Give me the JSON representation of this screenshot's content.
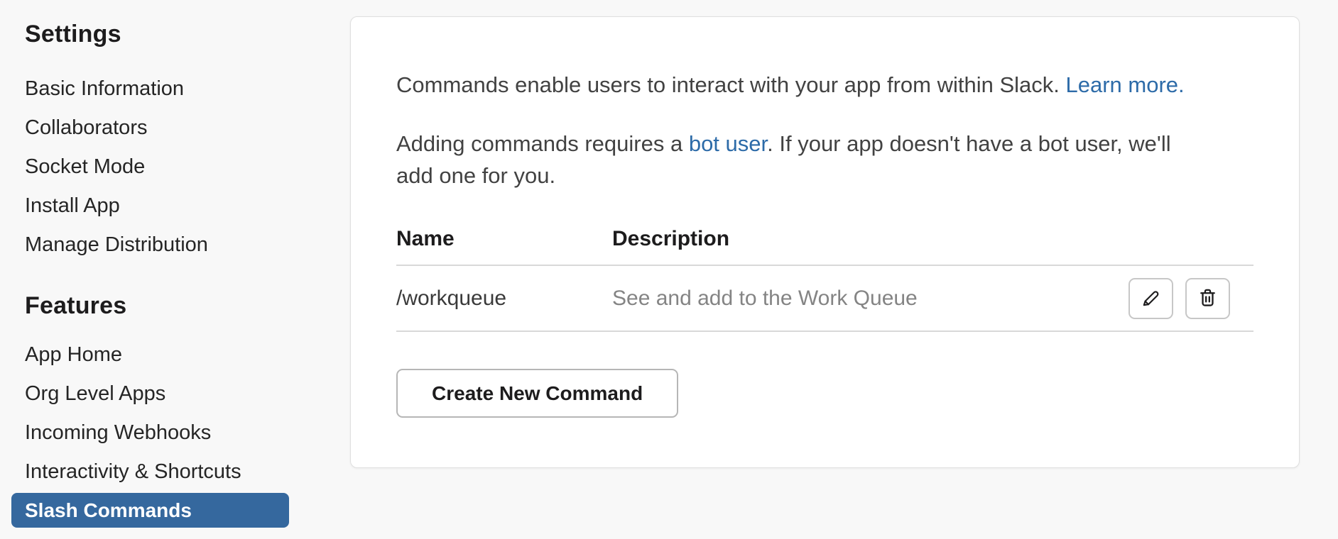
{
  "colors": {
    "accent": "#35689e",
    "link": "#2d6ba8",
    "page_background": "#f8f8f8",
    "description_text": "#848484"
  },
  "sidebar": {
    "sections": [
      {
        "heading": "Settings",
        "items": [
          "Basic Information",
          "Collaborators",
          "Socket Mode",
          "Install App",
          "Manage Distribution"
        ]
      },
      {
        "heading": "Features",
        "items": [
          "App Home",
          "Org Level Apps",
          "Incoming Webhooks",
          "Interactivity & Shortcuts"
        ],
        "active_item": "Slash Commands"
      }
    ]
  },
  "main": {
    "intro_line1": {
      "text": "Commands enable users to interact with your app from within Slack. ",
      "link": "Learn more."
    },
    "intro_line2": {
      "prefix": "Adding commands requires a ",
      "link": "bot user",
      "suffix": ". If your app doesn't have a bot user, we'll add one for you."
    },
    "table": {
      "name_header": "Name",
      "description_header": "Description",
      "rows": [
        {
          "name": "/workqueue",
          "description": "See and add to the Work Queue"
        }
      ]
    },
    "create_button": "Create New Command"
  }
}
